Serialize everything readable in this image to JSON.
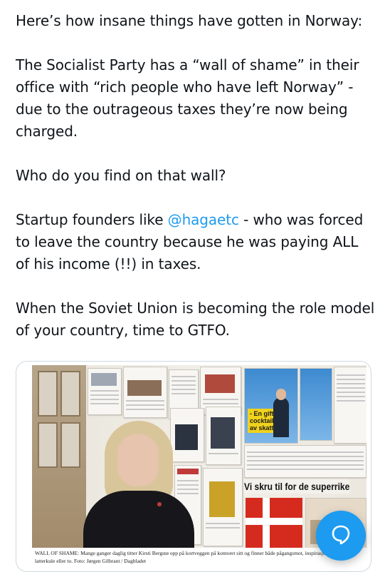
{
  "tweet": {
    "line1": "Here’s how insane things have gotten in Norway:",
    "p2": "The Socialist Party has a “wall of shame” in their office with “rich people who have left Norway” - due to the outrageous taxes they’re now being charged.",
    "p3": "Who do you find on that wall?",
    "p4_before": "Startup founders like ",
    "p4_mention": "@hagaetc",
    "p4_after": " - who was forced to leave the country because he was paying ALL of his income (!!) in taxes.",
    "p5": "When the Soviet Union is becoming the role model of your country, time to GTFO."
  },
  "media": {
    "photo_headline": "Vi skru til for de superrike i Sveits",
    "photo_tag_1": "- En giftig",
    "photo_tag_2": "cocktail",
    "photo_tag_3": "av skatt",
    "caption_line1": "WALL OF SHAME: Mange ganger daglig titter Kirsti Bergstø opp på kortveggen på kontoret sitt og finner både pågangsmot, inspirasjon",
    "caption_line2": "latterkule eller to. Foto: Jørgen Gilbrant / Dagbladet"
  },
  "compose": {
    "icon": "compose-reply-icon"
  },
  "colors": {
    "accent": "#1d9bf0",
    "text": "#0f1419"
  }
}
